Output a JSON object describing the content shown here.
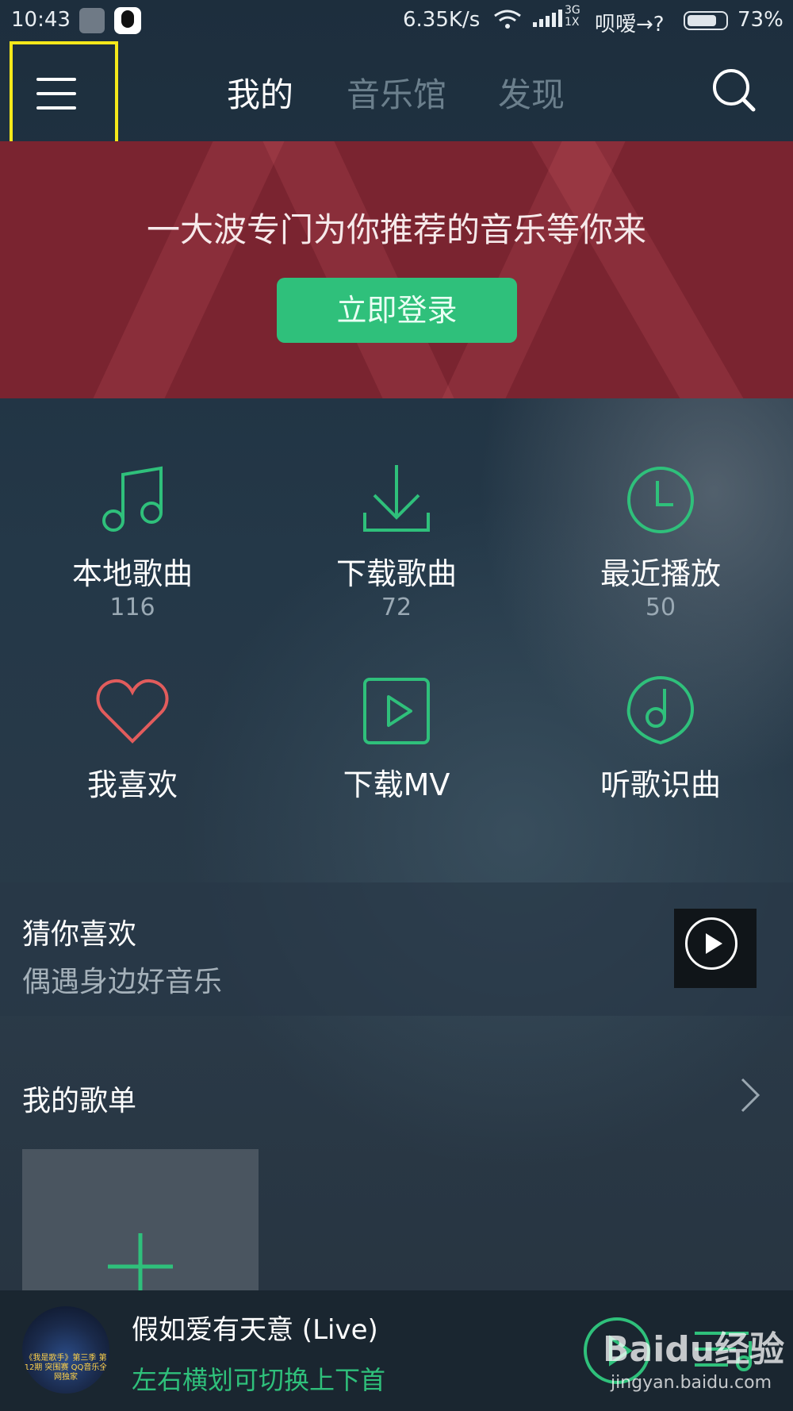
{
  "status_bar": {
    "time": "10:43",
    "net_speed": "6.35K/s",
    "net_type_top": "3G",
    "net_type_bottom": "1X",
    "carrier": "呗嗳→?",
    "battery": "73%"
  },
  "header": {
    "tabs": [
      {
        "label": "我的",
        "active": true
      },
      {
        "label": "音乐馆",
        "active": false
      },
      {
        "label": "发现",
        "active": false
      }
    ]
  },
  "banner": {
    "title": "一大波专门为你推荐的音乐等你来",
    "login_label": "立即登录"
  },
  "grid": [
    {
      "label": "本地歌曲",
      "count": "116",
      "icon": "music-note-icon"
    },
    {
      "label": "下载歌曲",
      "count": "72",
      "icon": "download-icon"
    },
    {
      "label": "最近播放",
      "count": "50",
      "icon": "clock-icon"
    },
    {
      "label": "我喜欢",
      "count": "",
      "icon": "heart-icon"
    },
    {
      "label": "下载MV",
      "count": "",
      "icon": "mv-play-icon"
    },
    {
      "label": "听歌识曲",
      "count": "",
      "icon": "recognize-music-icon"
    }
  ],
  "guess": {
    "title": "猜你喜欢",
    "subtitle": "偶遇身边好音乐"
  },
  "playlists": {
    "heading": "我的歌单"
  },
  "player": {
    "song": "假如爱有天意 (Live)",
    "hint": "左右横划可切换上下首",
    "cover_text": "《我是歌手》第三季 第12期 突围赛 QQ音乐全网独家"
  },
  "watermark": {
    "logo": "Baidu经验",
    "url": "jingyan.baidu.com"
  },
  "colors": {
    "accent_green": "#2fc07b",
    "heart_red": "#e25c5c",
    "banner_red": "#7a2430",
    "highlight_yellow": "#f5e81a"
  }
}
